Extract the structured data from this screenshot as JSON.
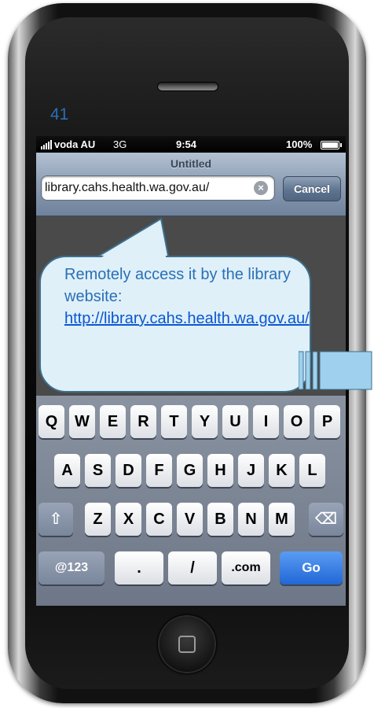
{
  "overlay": {
    "page_number": "41"
  },
  "status_bar": {
    "carrier": "voda AU",
    "network": "3G",
    "time": "9:54",
    "battery": "100%"
  },
  "nav_bar": {
    "title": "Untitled",
    "url": "library.cahs.health.wa.gov.au/",
    "cancel_label": "Cancel",
    "clear_icon": "×"
  },
  "callout": {
    "line1": "Remotely access it by the library website:",
    "link": "http://library.cahs.health.wa.gov.au/"
  },
  "keyboard": {
    "row1": [
      "Q",
      "W",
      "E",
      "R",
      "T",
      "Y",
      "U",
      "I",
      "O",
      "P"
    ],
    "row2": [
      "A",
      "S",
      "D",
      "F",
      "G",
      "H",
      "J",
      "K",
      "L"
    ],
    "row3": [
      "Z",
      "X",
      "C",
      "V",
      "B",
      "N",
      "M"
    ],
    "shift_icon": "⇧",
    "delete_icon": "⌫",
    "numbers_label": "@123",
    "period_label": ".",
    "slash_label": "/",
    "com_label": ".com",
    "go_label": "Go"
  }
}
